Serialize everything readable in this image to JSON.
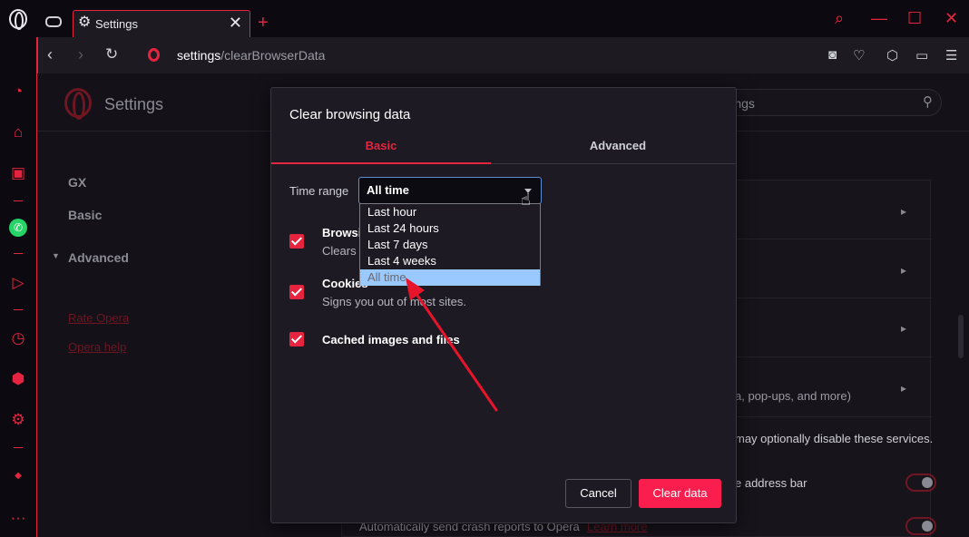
{
  "browser": {
    "tab_title": "Settings",
    "tab_close": "✕",
    "new_tab": "+",
    "url_host": "settings",
    "url_path": "/clearBrowserData"
  },
  "settings_page": {
    "title": "Settings",
    "search_placeholder": "n settings",
    "leftnav": {
      "gx": "GX",
      "basic": "Basic",
      "advanced": "Advanced",
      "rate_opera": "Rate Opera",
      "opera_help": "Opera help"
    },
    "background_texts": {
      "popups": "a, pop-ups, and more)",
      "services": "may optionally disable these services.",
      "address_bar": "e address bar",
      "crash_reports": "Automatically send crash reports to Opera",
      "learn_more": "Learn more"
    }
  },
  "dialog": {
    "title": "Clear browsing data",
    "tabs": [
      "Basic",
      "Advanced"
    ],
    "active_tab": "Basic",
    "time_range_label": "Time range",
    "time_range_value": "All time",
    "time_range_options": [
      "Last hour",
      "Last 24 hours",
      "Last 7 days",
      "Last 4 weeks",
      "All time"
    ],
    "checkboxes": [
      {
        "title": "Browsi",
        "desc": "Clears l",
        "checked": true
      },
      {
        "title": "Cookies",
        "desc": "Signs you out of most sites.",
        "checked": true
      },
      {
        "title": "Cached images and files",
        "desc": "",
        "checked": true
      }
    ],
    "cancel_label": "Cancel",
    "clear_label": "Clear data"
  },
  "colors": {
    "accent": "#e6243f",
    "clear_button": "#fa1e4e",
    "dropdown_selected": "#99c9ff",
    "annotation_arrow": "#e8142b"
  },
  "icons": {
    "sidebar": [
      "speed-dial-icon",
      "gift-icon",
      "twitch-icon",
      "whatsapp-icon",
      "player-icon",
      "history-icon",
      "cube-icon",
      "settings-icon",
      "ublock-icon",
      "more-icon"
    ],
    "toolbar": [
      "camera-icon",
      "heart-icon",
      "cube-icon",
      "battery-icon",
      "menu-icon"
    ]
  }
}
